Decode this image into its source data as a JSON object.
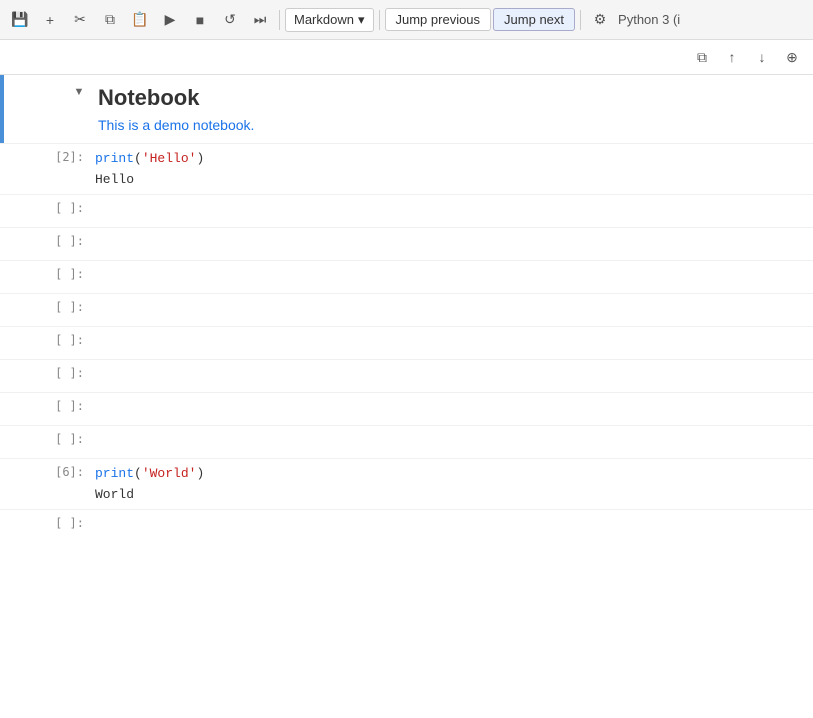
{
  "toolbar": {
    "save_label": "💾",
    "add_label": "+",
    "cut_label": "✂",
    "copy_label": "⧉",
    "paste_label": "📋",
    "run_label": "▶",
    "stop_label": "■",
    "restart_label": "↺",
    "fast_forward_label": "⏭",
    "kernel_dropdown": "Markdown",
    "jump_previous_label": "Jump previous",
    "jump_next_label": "Jump next",
    "kernel_icon": "⚙",
    "python_label": "Python 3 (i"
  },
  "cell_actions": {
    "copy_icon": "⧉",
    "up_icon": "↑",
    "down_icon": "↓",
    "more_icon": "⊕"
  },
  "notebook": {
    "title": "Notebook",
    "description": "This is a demo notebook."
  },
  "cells": [
    {
      "type": "code",
      "num": "[2]:",
      "code_parts": [
        {
          "text": "print",
          "class": "kw-func"
        },
        {
          "text": "(",
          "class": "kw-paren"
        },
        {
          "text": "'Hello'",
          "class": "kw-str"
        },
        {
          "text": ")",
          "class": "kw-paren"
        }
      ],
      "output": "Hello"
    },
    {
      "type": "empty",
      "num": "[ ]:"
    },
    {
      "type": "empty",
      "num": "[ ]:"
    },
    {
      "type": "empty",
      "num": "[ ]:"
    },
    {
      "type": "empty",
      "num": "[ ]:"
    },
    {
      "type": "empty",
      "num": "[ ]:"
    },
    {
      "type": "empty",
      "num": "[ ]:"
    },
    {
      "type": "empty",
      "num": "[ ]:"
    },
    {
      "type": "empty",
      "num": "[ ]:"
    },
    {
      "type": "code",
      "num": "[6]:",
      "code_parts": [
        {
          "text": "print",
          "class": "kw-func"
        },
        {
          "text": "(",
          "class": "kw-paren"
        },
        {
          "text": "'World'",
          "class": "kw-str"
        },
        {
          "text": ")",
          "class": "kw-paren"
        }
      ],
      "output": "World"
    },
    {
      "type": "empty",
      "num": "[ ]:"
    }
  ]
}
